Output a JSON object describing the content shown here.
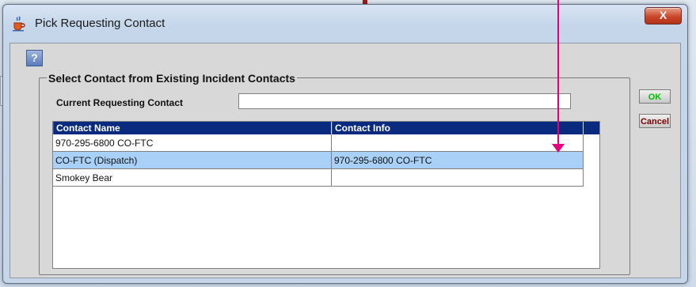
{
  "window": {
    "title": "Pick Requesting Contact",
    "title_icon": "java-cup-icon",
    "close_label": "X"
  },
  "help": {
    "icon": "help-icon",
    "label": "?"
  },
  "group": {
    "title": "Select Contact from Existing Incident Contacts"
  },
  "current_contact": {
    "label": "Current Requesting Contact",
    "value": ""
  },
  "table": {
    "columns": [
      "Contact Name",
      "Contact Info"
    ],
    "rows": [
      {
        "name": "970-295-6800  CO-FTC",
        "info": "",
        "selected": false
      },
      {
        "name": "CO-FTC (Dispatch)",
        "info": "970-295-6800  CO-FTC",
        "selected": true
      },
      {
        "name": "Smokey Bear",
        "info": "",
        "selected": false
      }
    ]
  },
  "buttons": {
    "ok": "OK",
    "cancel": "Cancel"
  },
  "colors": {
    "header_bg": "#0a2a80",
    "selected_row": "#a9d1f7",
    "close_button": "#c9472a",
    "ok_text": "#00c000",
    "annotation_arrow": "#e0007c"
  }
}
